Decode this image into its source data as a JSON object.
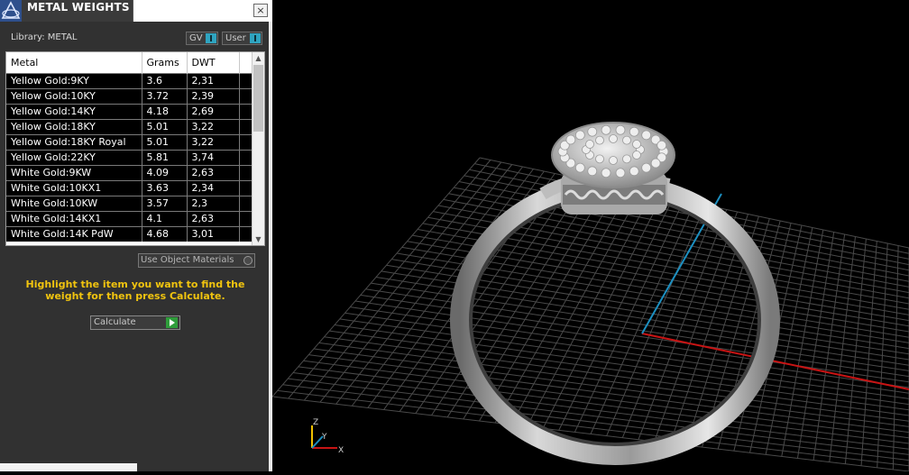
{
  "panel": {
    "title": "METAL WEIGHTS",
    "close_label": "×",
    "library_label": "Library: METAL",
    "toggles": [
      {
        "label": "GV"
      },
      {
        "label": "User"
      }
    ],
    "columns": [
      "Metal",
      "Grams",
      "DWT"
    ],
    "rows": [
      {
        "metal": "Yellow Gold:9KY",
        "grams": "3.6",
        "dwt": "2,31"
      },
      {
        "metal": "Yellow Gold:10KY",
        "grams": "3.72",
        "dwt": "2,39"
      },
      {
        "metal": "Yellow Gold:14KY",
        "grams": "4.18",
        "dwt": "2,69"
      },
      {
        "metal": "Yellow Gold:18KY",
        "grams": "5.01",
        "dwt": "3,22"
      },
      {
        "metal": "Yellow Gold:18KY Royal",
        "grams": "5.01",
        "dwt": "3,22"
      },
      {
        "metal": "Yellow Gold:22KY",
        "grams": "5.81",
        "dwt": "3,74"
      },
      {
        "metal": "White Gold:9KW",
        "grams": "4.09",
        "dwt": "2,63"
      },
      {
        "metal": "White Gold:10KX1",
        "grams": "3.63",
        "dwt": "2,34"
      },
      {
        "metal": "White Gold:10KW",
        "grams": "3.57",
        "dwt": "2,3"
      },
      {
        "metal": "White Gold:14KX1",
        "grams": "4.1",
        "dwt": "2,63"
      },
      {
        "metal": "White Gold:14K PdW",
        "grams": "4.68",
        "dwt": "3,01"
      }
    ],
    "use_object_materials": "Use Object Materials",
    "instruction": "Highlight the item you want to find the weight for then press Calculate.",
    "calculate_label": "Calculate"
  },
  "viewport": {
    "axis_labels": {
      "z": "Z",
      "y": "Y",
      "x": "X"
    }
  },
  "colors": {
    "panel_bg": "#313131",
    "instruction": "#f1c40f",
    "toggle_accent": "#2fa4c0",
    "calculate_accent": "#2e9d3a",
    "grid": "#4a4a4a",
    "x_axis": "#c81414",
    "y_axis": "#1c8fc0"
  },
  "icons": {
    "logo": "app-logo-icon",
    "close": "close-icon",
    "calculate": "play-arrow-icon"
  }
}
